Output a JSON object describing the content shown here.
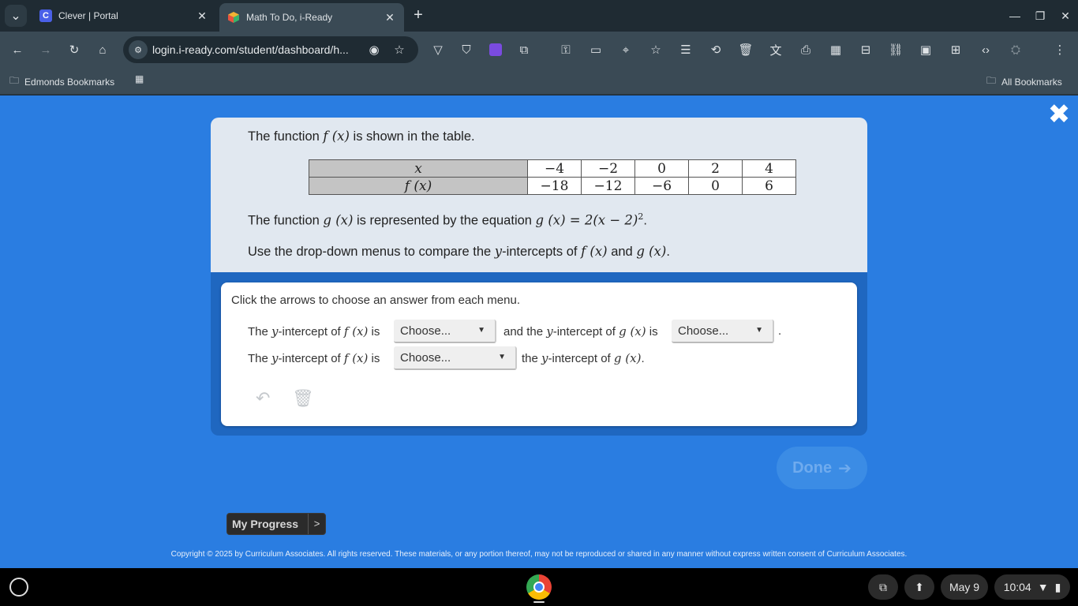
{
  "browser": {
    "tabs": [
      {
        "title": "Clever | Portal",
        "favicon": "clever-favicon",
        "favicon_letter": "C",
        "favicon_color": "#4a60e8"
      },
      {
        "title": "Math To Do, i-Ready",
        "favicon": "iready-cube-favicon"
      }
    ],
    "url": "login.i-ready.com/student/dashboard/h...",
    "bookmarks": {
      "folder": "Edmonds Bookmarks",
      "all": "All Bookmarks"
    }
  },
  "problem": {
    "intro_pre": "The function ",
    "fx": "f (x)",
    "intro_post": " is shown in the table.",
    "table": {
      "header_x": "x",
      "header_fx": "f (x)",
      "x_values": [
        "−4",
        "−2",
        "0",
        "2",
        "4"
      ],
      "fx_values": [
        "−18",
        "−12",
        "−6",
        "0",
        "6"
      ]
    },
    "g_line_pre": "The function ",
    "gx": "g (x)",
    "g_line_mid": " is represented by the equation ",
    "g_equation": "g (x) = 2(x − 2)",
    "g_exponent": "2",
    "g_line_end": ".",
    "instruction_pre": "Use the drop-down menus to compare the ",
    "y_var": "y",
    "instruction_mid": "-intercepts of ",
    "and": " and ",
    "period": "."
  },
  "answer": {
    "prompt": "Click the arrows to choose an answer from each menu.",
    "line1_a": "The ",
    "line1_b": "-intercept of ",
    "is": " is",
    "and_the": "and the ",
    "line2_end": "the ",
    "dropdown_placeholder": "Choose...",
    "period": "."
  },
  "nav": {
    "done": "Done",
    "progress": "My Progress",
    "progress_arrow": ">"
  },
  "footer": {
    "copyright": "Copyright © 2025 by Curriculum Associates. All rights reserved. These materials, or any portion thereof, may not be reproduced or shared in any manner without express written consent of Curriculum Associates."
  },
  "shelf": {
    "date": "May 9",
    "time": "10:04"
  }
}
